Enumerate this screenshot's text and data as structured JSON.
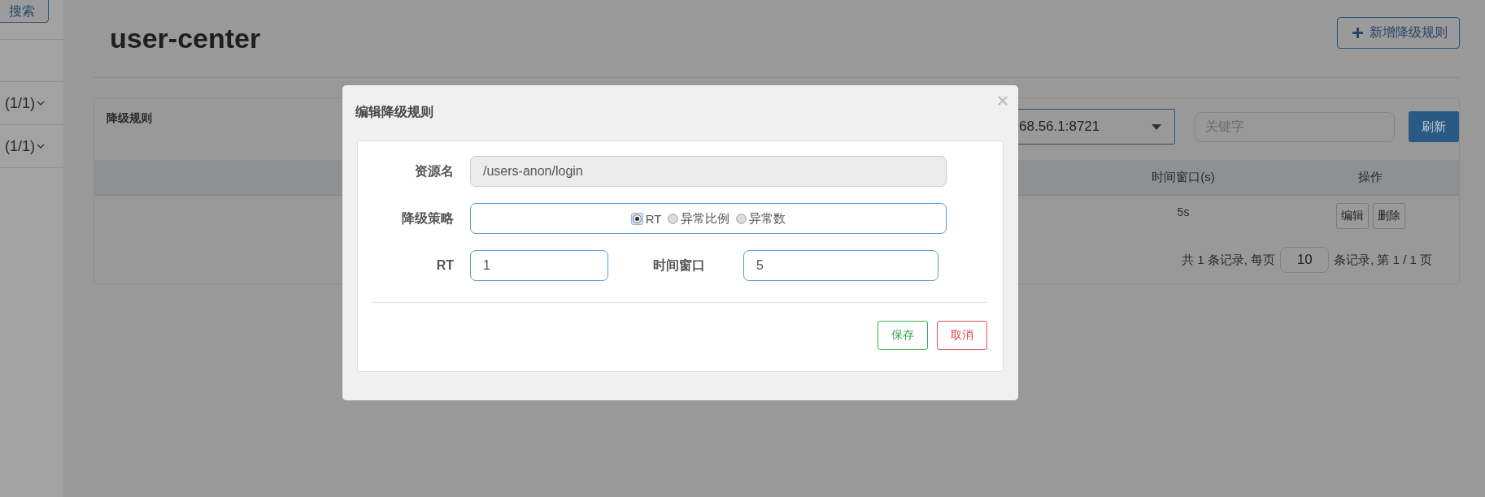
{
  "sidebar": {
    "search_button": "搜索",
    "items": [
      {
        "label": "(1/1)"
      },
      {
        "label": "(1/1)"
      }
    ]
  },
  "header": {
    "title": "user-center",
    "add_button": "新增降级规则"
  },
  "panel": {
    "title": "降级规则",
    "machine_select": {
      "value": "68.56.1:8721"
    },
    "keyword_search": {
      "placeholder": "关键字"
    },
    "refresh_button": "刷新",
    "table": {
      "columns": [
        "时间窗口(s)",
        "操作"
      ],
      "rows": [
        {
          "time_window": "5s",
          "actions": [
            "编辑",
            "删除"
          ]
        }
      ]
    },
    "pagination": {
      "prefix": "共 1 条记录, 每页",
      "page_size": "10",
      "suffix": "条记录, 第 1 / 1 页"
    }
  },
  "modal": {
    "title": "编辑降级规则",
    "resource": {
      "label": "资源名",
      "value": "/users-anon/login",
      "disabled": true
    },
    "strategy": {
      "label": "降级策略",
      "options": [
        {
          "label": "RT",
          "selected": true
        },
        {
          "label": "异常比例",
          "selected": false
        },
        {
          "label": "异常数",
          "selected": false
        }
      ]
    },
    "rt": {
      "label": "RT",
      "value": "1"
    },
    "time_window": {
      "label": "时间窗口",
      "value": "5"
    },
    "buttons": [
      {
        "label": "保存",
        "kind": "save"
      },
      {
        "label": "取消",
        "kind": "cancel"
      }
    ]
  }
}
